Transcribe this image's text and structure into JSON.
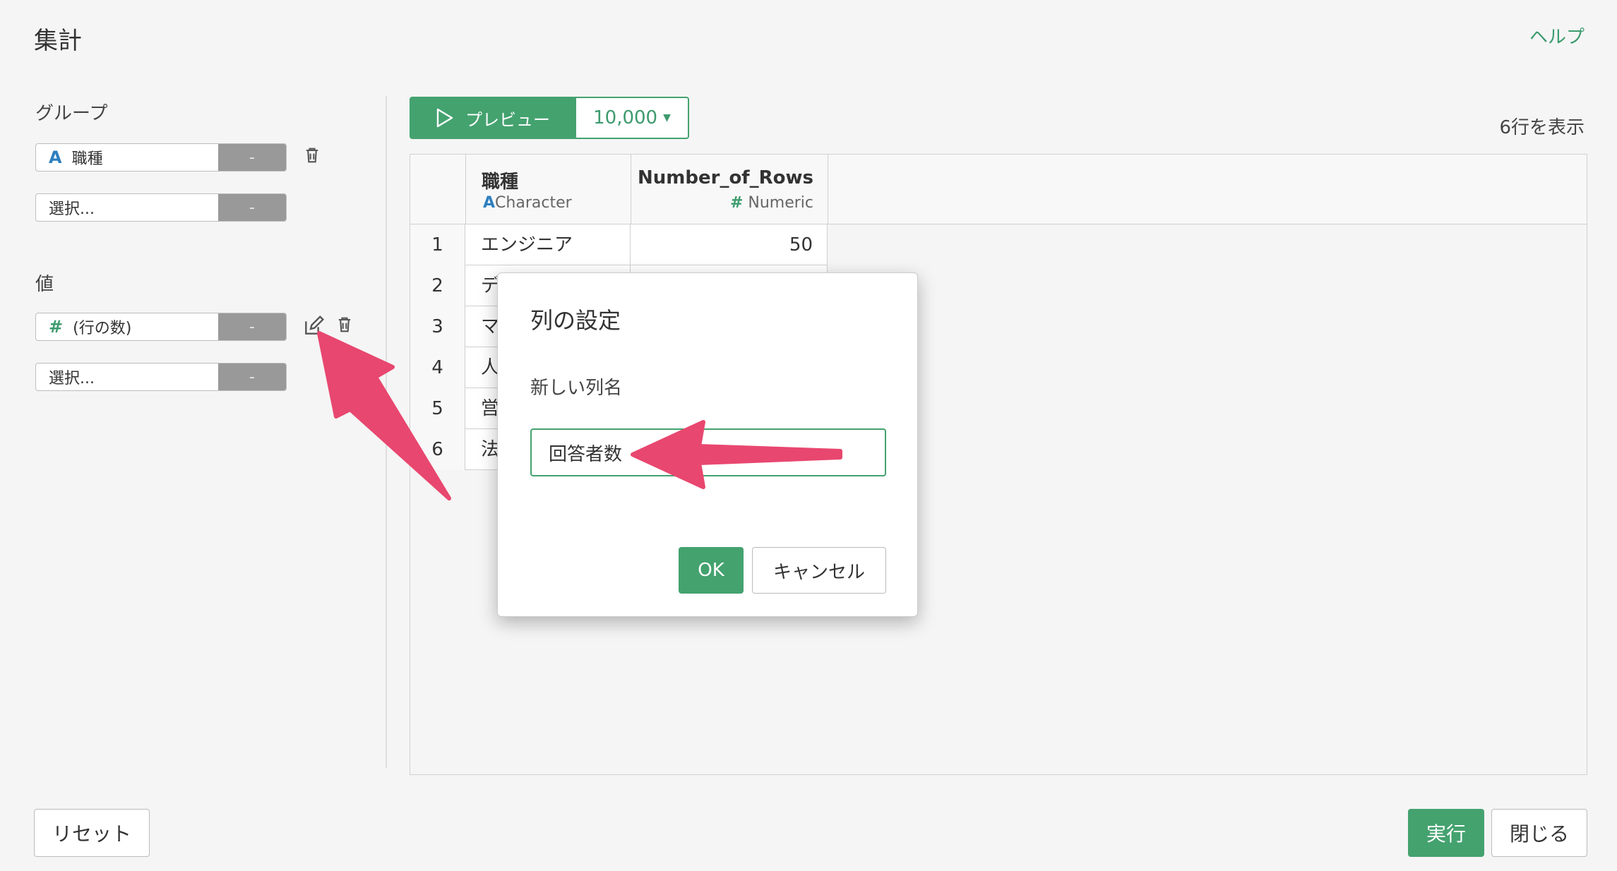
{
  "header": {
    "title": "集計",
    "help": "ヘルプ"
  },
  "group": {
    "label": "グループ",
    "fields": [
      {
        "type_icon": "A",
        "value": "職種",
        "action": "-"
      },
      {
        "type_icon": "",
        "value": "選択...",
        "action": "-"
      }
    ]
  },
  "values": {
    "label": "値",
    "fields": [
      {
        "type_icon": "#",
        "value": "(行の数)",
        "action": "-"
      },
      {
        "type_icon": "",
        "value": "選択...",
        "action": "-"
      }
    ]
  },
  "preview": {
    "button_label": "プレビュー",
    "rows_option": "10,000",
    "row_count_text": "6行を表示"
  },
  "table": {
    "columns": [
      {
        "name": "職種",
        "type_icon": "A",
        "type": "Character"
      },
      {
        "name": "Number_of_Rows",
        "type_icon": "#",
        "type": "Numeric"
      }
    ],
    "rows": [
      {
        "index": "1",
        "c1": "エンジニア",
        "c2": "50"
      },
      {
        "index": "2",
        "c1": "デ",
        "c2": ""
      },
      {
        "index": "3",
        "c1": "マ",
        "c2": ""
      },
      {
        "index": "4",
        "c1": "人",
        "c2": ""
      },
      {
        "index": "5",
        "c1": "営",
        "c2": ""
      },
      {
        "index": "6",
        "c1": "法",
        "c2": ""
      }
    ]
  },
  "dialog": {
    "title": "列の設定",
    "label": "新しい列名",
    "input_value": "回答者数",
    "ok": "OK",
    "cancel": "キャンセル"
  },
  "footer": {
    "reset": "リセット",
    "run": "実行",
    "close": "閉じる"
  },
  "colors": {
    "accent": "#44a26f",
    "arrow": "#e8476f"
  }
}
